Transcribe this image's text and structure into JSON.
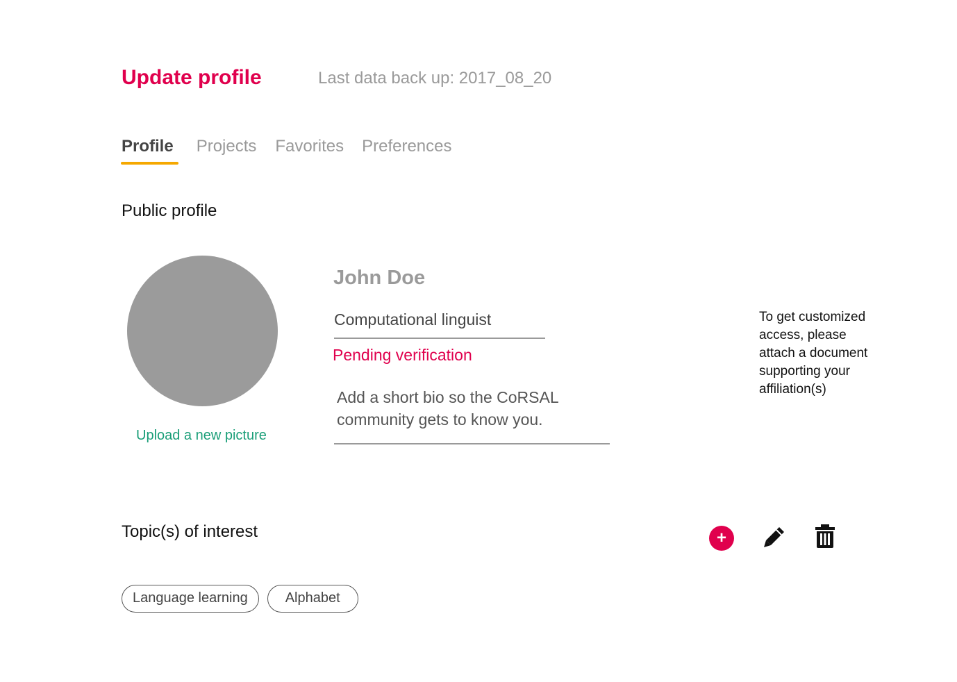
{
  "header": {
    "title": "Update profile",
    "backup_text": "Last data back up: 2017_08_20"
  },
  "tabs": [
    {
      "label": "Profile",
      "active": true
    },
    {
      "label": "Projects",
      "active": false
    },
    {
      "label": "Favorites",
      "active": false
    },
    {
      "label": "Preferences",
      "active": false
    }
  ],
  "public_profile": {
    "section_title": "Public profile",
    "upload_label": "Upload a new picture",
    "name": "John Doe",
    "job_title": "Computational linguist",
    "status": "Pending verification",
    "bio_placeholder": "Add a short bio so the CoRSAL community gets to know you.",
    "affiliation_note": "To get customized access, please attach a document supporting your affiliation(s)"
  },
  "topics": {
    "section_title": "Topic(s) of interest",
    "actions": {
      "add_icon": "plus-icon",
      "add_symbol": "+",
      "edit_icon": "pencil-icon",
      "delete_icon": "trash-icon"
    },
    "items": [
      "Language learning",
      "Alphabet"
    ]
  },
  "colors": {
    "accent": "#e0004d",
    "tab_indicator": "#f5a800",
    "link": "#1a9e78",
    "muted": "#9a9a9a",
    "avatar": "#9b9b9b"
  }
}
